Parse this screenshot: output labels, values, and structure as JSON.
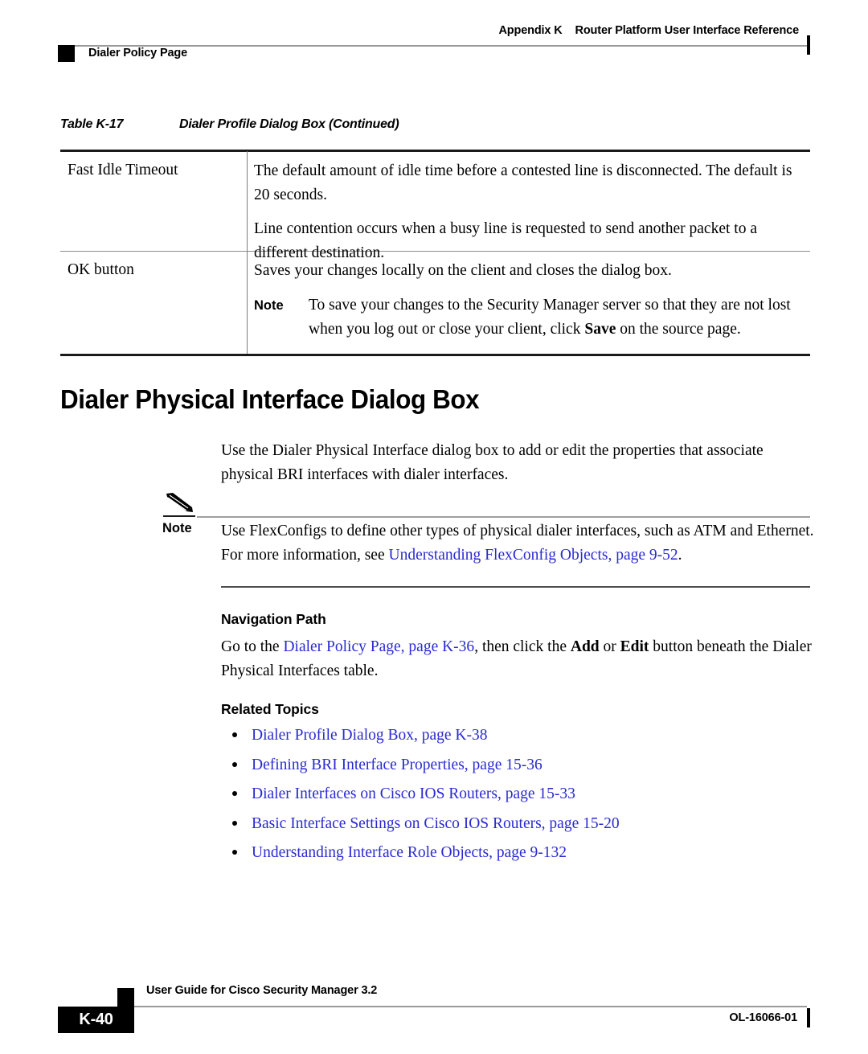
{
  "header": {
    "appendix": "Appendix K",
    "title": "Router Platform User Interface Reference",
    "section": "Dialer Policy Page"
  },
  "table": {
    "caption_number": "Table K-17",
    "caption_title": "Dialer Profile Dialog Box (Continued)",
    "rows": [
      {
        "label": "Fast Idle Timeout",
        "paragraphs": [
          "The default amount of idle time before a contested line is disconnected. The default is 20 seconds.",
          "Line contention occurs when a busy line is requested to send another packet to a different destination."
        ]
      },
      {
        "label": "OK button",
        "paragraphs": [
          "Saves your changes locally on the client and closes the dialog box."
        ],
        "note": {
          "label": "Note",
          "text_before": "To save your changes to the Security Manager server so that they are not lost when you log out or close your client, click ",
          "bold_term": "Save",
          "text_after": " on the source page."
        }
      }
    ]
  },
  "section": {
    "heading": "Dialer Physical Interface Dialog Box",
    "intro": "Use the Dialer Physical Interface dialog box to add or edit the properties that associate physical BRI interfaces with dialer interfaces.",
    "note": {
      "icon": "pencil-icon",
      "label": "Note",
      "text_before": "Use FlexConfigs to define other types of physical dialer interfaces, such as ATM and Ethernet. For more information, see ",
      "link": "Understanding FlexConfig Objects, page 9-52",
      "text_after": "."
    },
    "navigation": {
      "heading": "Navigation Path",
      "text_before": "Go to the ",
      "link": "Dialer Policy Page, page K-36",
      "text_mid": ", then click the ",
      "bold_add": "Add",
      "text_or": " or ",
      "bold_edit": "Edit",
      "text_after": " button beneath the Dialer Physical Interfaces table."
    },
    "related": {
      "heading": "Related Topics",
      "items": [
        "Dialer Profile Dialog Box, page K-38",
        "Defining BRI Interface Properties, page 15-36",
        "Dialer Interfaces on Cisco IOS Routers, page 15-33",
        "Basic Interface Settings on Cisco IOS Routers, page 15-20",
        "Understanding Interface Role Objects, page 9-132"
      ]
    }
  },
  "footer": {
    "guide": "User Guide for Cisco Security Manager 3.2",
    "page_number": "K-40",
    "doc_id": "OL-16066-01"
  },
  "colors": {
    "link": "#2a2ad0",
    "rule_gray": "#9a9a9a",
    "rule_dark": "#1a1a1a"
  }
}
